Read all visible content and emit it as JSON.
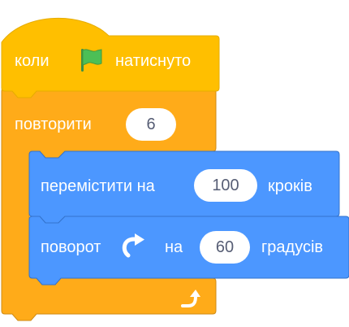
{
  "colors": {
    "events": "#ffbf00",
    "events_border": "#e6ac00",
    "control": "#ffab19",
    "control_border": "#cf8b17",
    "motion": "#4c97ff",
    "motion_border": "#3373cc",
    "flag": "#4cbf56",
    "text": "#ffffff",
    "input_text": "#575e75"
  },
  "event_block": {
    "label_before": "коли",
    "icon": "green-flag-icon",
    "label_after": "натиснуто"
  },
  "repeat_block": {
    "label": "повторити",
    "count": "6",
    "loop_icon": "loop-arrow-icon"
  },
  "move_block": {
    "label_before": "перемістити на",
    "steps": "100",
    "label_after": "кроків"
  },
  "turn_block": {
    "label_before": "поворот",
    "icon": "rotate-right-icon",
    "label_middle": "на",
    "degrees": "60",
    "label_after": "градусів"
  }
}
